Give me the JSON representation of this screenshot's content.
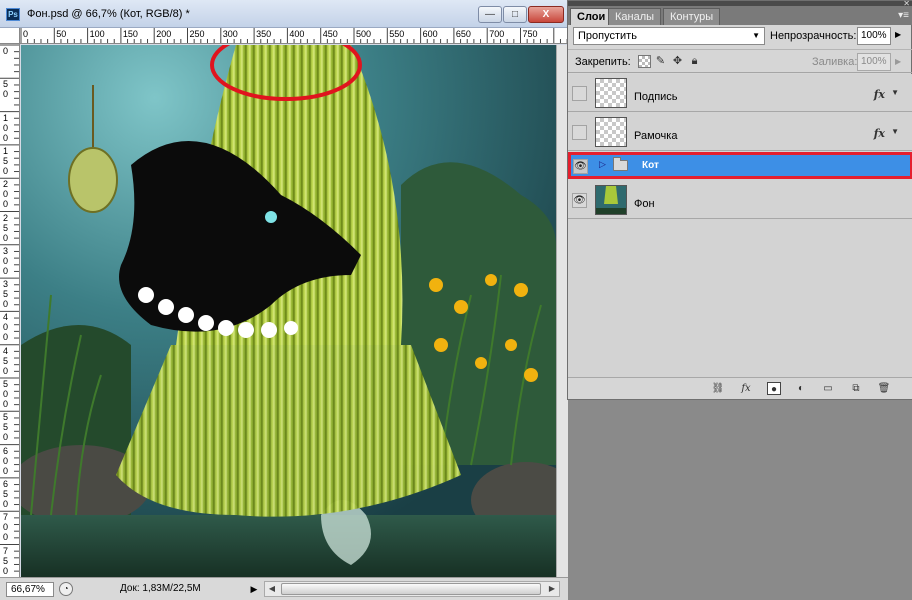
{
  "document": {
    "app_icon_text": "Ps",
    "title": "Фон.psd @ 66,7% (Кот, RGB/8) *",
    "window_buttons": {
      "minimize": "—",
      "maximize": "□",
      "close": "X"
    },
    "ruler_top_labels": [
      "0",
      "50",
      "100",
      "150",
      "200",
      "250",
      "300",
      "350",
      "400",
      "450",
      "500",
      "550",
      "600",
      "650",
      "700",
      "750"
    ],
    "ruler_left_labels": [
      "0",
      "5 0",
      "1 0 0",
      "1 5 0",
      "2 0 0",
      "2 5 0",
      "3 0 0",
      "3 5 0",
      "4 0 0",
      "4 5 0",
      "5 0 0",
      "5 5 0",
      "6 0 0",
      "6 5 0",
      "7 0 0",
      "7 5 0"
    ],
    "zoom": "66,67%",
    "doc_size": "Док: 1,83М/22,5М"
  },
  "layers_panel": {
    "tabs": [
      {
        "label": "Слои",
        "active": true
      },
      {
        "label": "Каналы",
        "active": false
      },
      {
        "label": "Контуры",
        "active": false
      }
    ],
    "blend_mode": "Пропустить",
    "opacity_label": "Непрозрачность:",
    "opacity": "100%",
    "lock_label": "Закрепить:",
    "fill_label": "Заливка:",
    "fill": "100%",
    "layers": [
      {
        "name": "Подпись",
        "visible": false,
        "has_fx": true,
        "type": "layer"
      },
      {
        "name": "Рамочка",
        "visible": false,
        "has_fx": true,
        "type": "layer"
      },
      {
        "name": "Кот",
        "visible": true,
        "has_fx": false,
        "type": "group",
        "selected": true
      },
      {
        "name": "Фон",
        "visible": true,
        "has_fx": false,
        "type": "layer"
      }
    ],
    "fx_label": "fx"
  },
  "colors": {
    "selection": "#3d8fe6",
    "highlight_red": "#e51f2e",
    "annotation_red": "#e0141e"
  }
}
